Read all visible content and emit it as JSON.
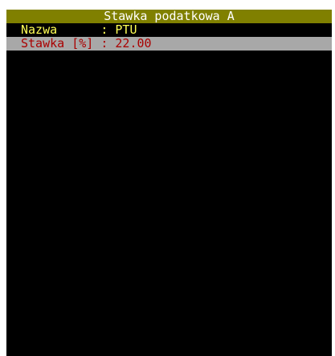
{
  "window": {
    "title": "Stawka podatkowa A"
  },
  "fields": [
    {
      "label": "Nazwa     ",
      "separator": " : ",
      "value": "PTU"
    },
    {
      "label": "Stawka [%]",
      "separator": " : ",
      "value": "22.00"
    }
  ],
  "colors": {
    "title_bg": "#808000",
    "title_fg": "#ffffff",
    "field_fg": "#ffff55",
    "selected_bg": "#a8a8a8",
    "selected_fg": "#aa0000",
    "screen_bg": "#000000"
  }
}
